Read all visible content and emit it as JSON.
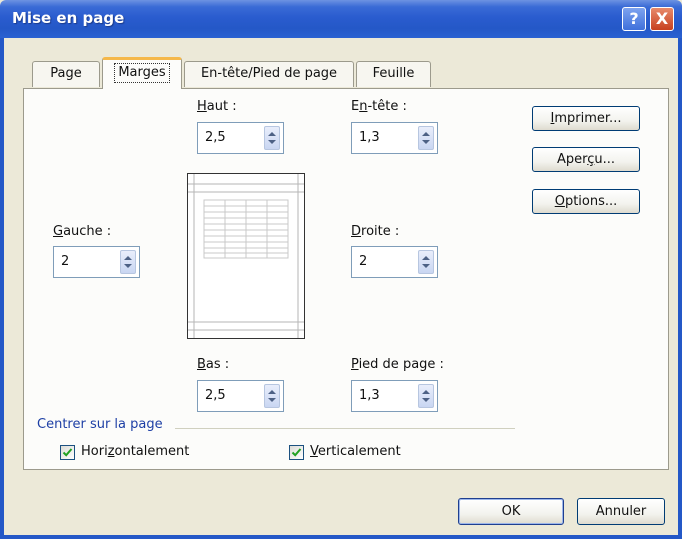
{
  "window": {
    "title": "Mise en page",
    "help_glyph": "?",
    "close_glyph": "X"
  },
  "tabs": [
    {
      "label": "Page"
    },
    {
      "label": "Marges",
      "active": true
    },
    {
      "label": "En-tête/Pied de page"
    },
    {
      "label": "Feuille"
    }
  ],
  "margins": {
    "haut": {
      "label_pre": "",
      "label_u": "H",
      "label_post": "aut :",
      "value": "2,5"
    },
    "entete": {
      "label_pre": "E",
      "label_u": "n",
      "label_post": "-tête :",
      "value": "1,3"
    },
    "gauche": {
      "label_pre": "",
      "label_u": "G",
      "label_post": "auche :",
      "value": "2"
    },
    "droite": {
      "label_pre": "",
      "label_u": "D",
      "label_post": "roite :",
      "value": "2"
    },
    "bas": {
      "label_pre": "",
      "label_u": "B",
      "label_post": "as :",
      "value": "2,5"
    },
    "pied": {
      "label_pre": "",
      "label_u": "P",
      "label_post": "ied de page :",
      "value": "1,3"
    }
  },
  "side_buttons": {
    "imprimer": {
      "pre": "",
      "u": "I",
      "post": "mprimer..."
    },
    "apercu": {
      "pre": "Aper",
      "u": "ç",
      "post": "u..."
    },
    "options": {
      "pre": "",
      "u": "O",
      "post": "ptions..."
    }
  },
  "centrer": {
    "title": "Centrer sur la page",
    "horizontal": {
      "pre": "Hori",
      "u": "z",
      "post": "ontalement",
      "checked": true
    },
    "vertical": {
      "pre": "",
      "u": "V",
      "post": "erticalement",
      "checked": true
    }
  },
  "footer": {
    "ok_label": "OK",
    "cancel_label": "Annuler"
  },
  "colors": {
    "titlebar": "#2458c7",
    "active_tab_accent": "#f5b84a",
    "group_title": "#1d3fa5"
  }
}
